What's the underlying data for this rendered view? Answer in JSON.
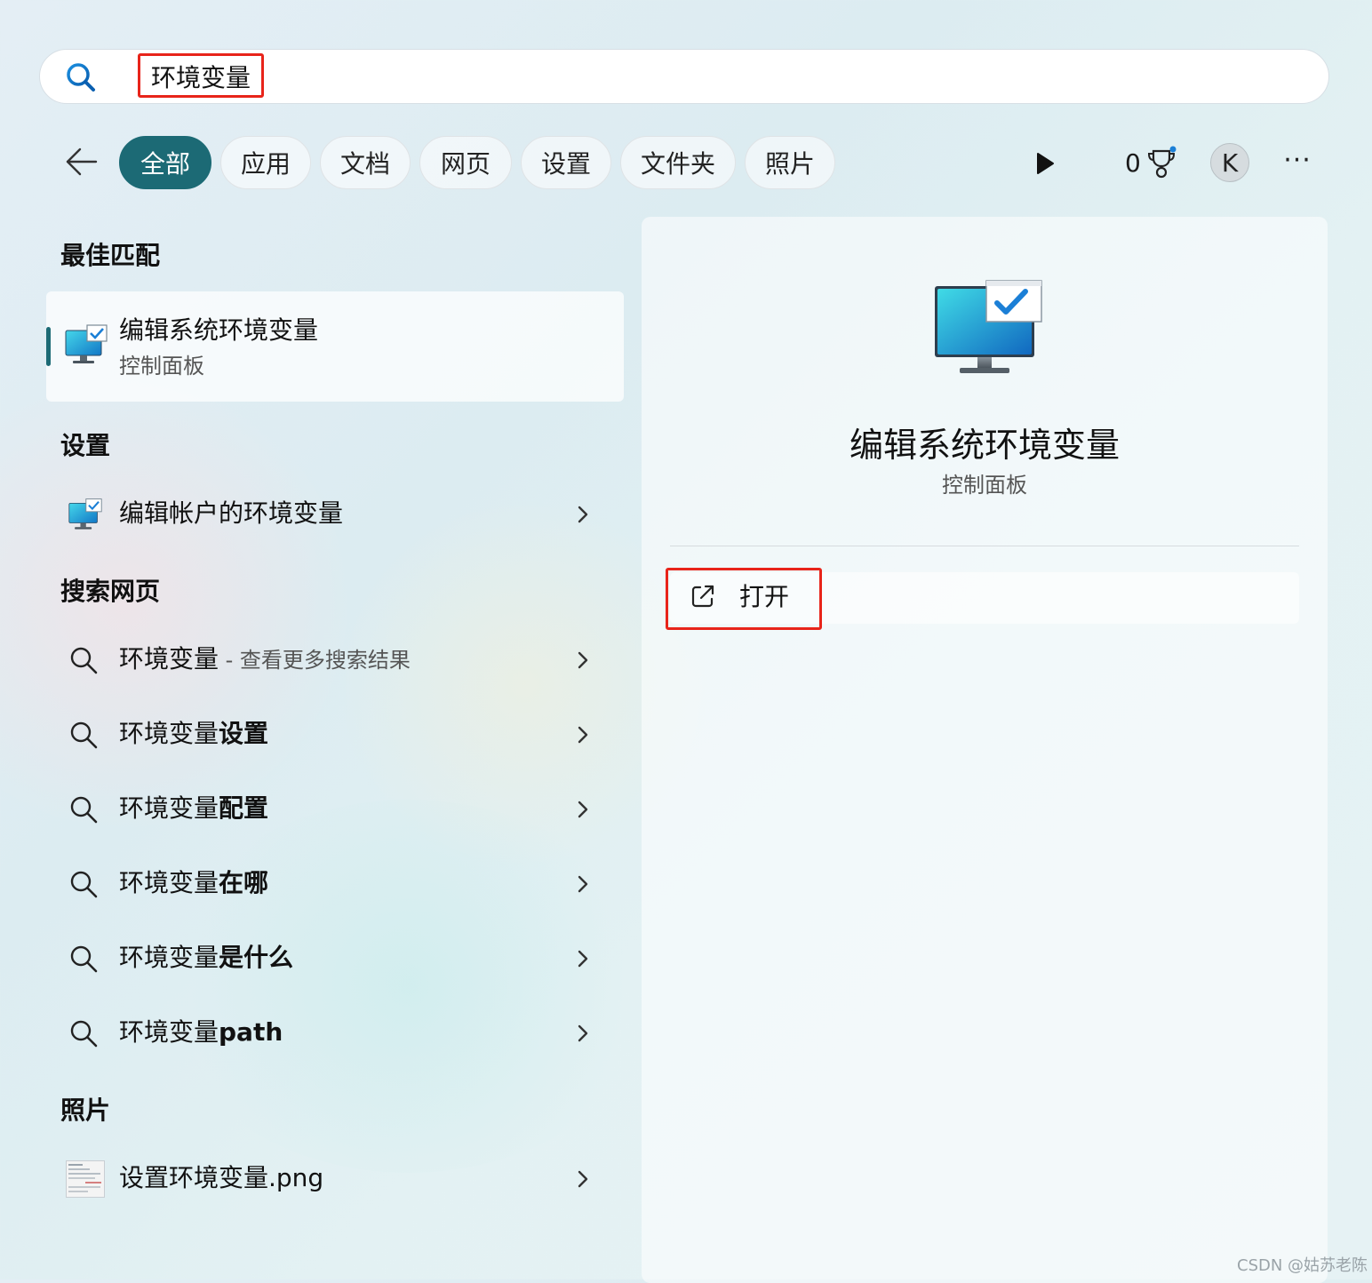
{
  "search": {
    "query": "环境变量"
  },
  "filters": [
    {
      "label": "全部",
      "active": true
    },
    {
      "label": "应用"
    },
    {
      "label": "文档"
    },
    {
      "label": "网页"
    },
    {
      "label": "设置"
    },
    {
      "label": "文件夹"
    },
    {
      "label": "照片"
    }
  ],
  "header": {
    "points": "0",
    "avatar_letter": "K",
    "more_label": "···"
  },
  "sections": {
    "best_match": "最佳匹配",
    "settings": "设置",
    "web": "搜索网页",
    "photos": "照片"
  },
  "best_match": {
    "title": "编辑系统环境变量",
    "subtitle": "控制面板"
  },
  "settings_items": [
    {
      "label": "编辑帐户的环境变量"
    }
  ],
  "web_items": [
    {
      "prefix": "环境变量",
      "bold": "",
      "hint": " - 查看更多搜索结果"
    },
    {
      "prefix": "环境变量",
      "bold": "设置",
      "hint": ""
    },
    {
      "prefix": "环境变量",
      "bold": "配置",
      "hint": ""
    },
    {
      "prefix": "环境变量",
      "bold": "在哪",
      "hint": ""
    },
    {
      "prefix": "环境变量",
      "bold": "是什么",
      "hint": ""
    },
    {
      "prefix": "环境变量",
      "bold": "path",
      "hint": ""
    }
  ],
  "photo_items": [
    {
      "label": "设置环境变量.png"
    }
  ],
  "detail": {
    "title": "编辑系统环境变量",
    "subtitle": "控制面板",
    "open_label": "打开"
  },
  "watermark": "CSDN @姑苏老陈",
  "colors": {
    "accent": "#1c6a75",
    "highlight_box": "#e8241a"
  }
}
